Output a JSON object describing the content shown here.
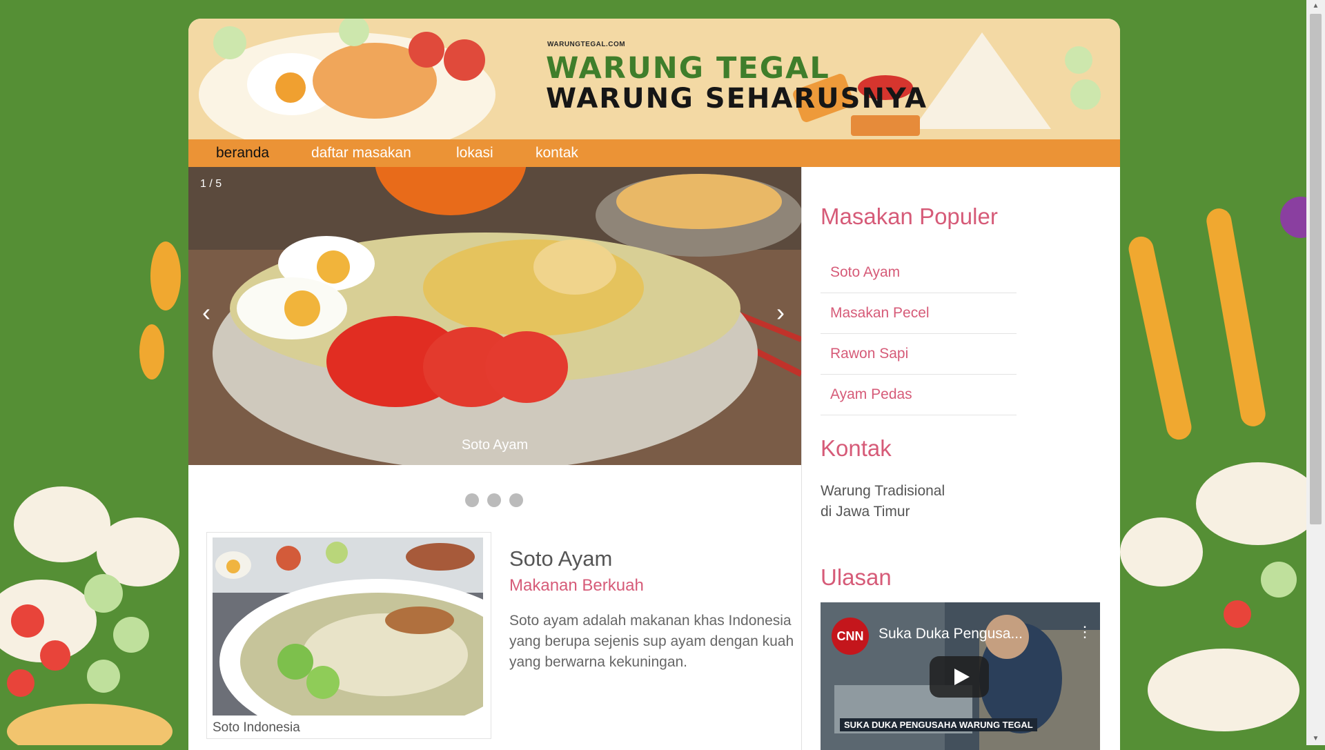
{
  "banner": {
    "site_url": "WARUNGTEGAL.COM",
    "title": "WARUNG TEGAL",
    "subtitle": "WARUNG SEHARUSNYA"
  },
  "nav": {
    "items": [
      {
        "label": "beranda"
      },
      {
        "label": "daftar masakan"
      },
      {
        "label": "lokasi"
      },
      {
        "label": "kontak"
      }
    ]
  },
  "slider": {
    "counter": "1 / 5",
    "caption": "Soto Ayam",
    "prev_glyph": "‹",
    "next_glyph": "›"
  },
  "article": {
    "image_caption": "Soto Indonesia",
    "title": "Soto Ayam",
    "subtitle": "Makanan Berkuah",
    "text": "Soto ayam adalah makanan khas Indonesia yang berupa sejenis sup ayam dengan kuah yang berwarna kekuningan."
  },
  "sidebar": {
    "popular_heading": "Masakan Populer",
    "popular_items": [
      {
        "label": "Soto Ayam"
      },
      {
        "label": "Masakan Pecel"
      },
      {
        "label": "Rawon Sapi"
      },
      {
        "label": "Ayam Pedas"
      }
    ],
    "contact_heading": "Kontak",
    "contact_line1": "Warung Tradisional",
    "contact_line2": "di Jawa Timur",
    "review_heading": "Ulasan",
    "video_title": "Suka Duka Pengusa...",
    "video_channel_logo": "CNN",
    "video_lower_text": "SUKA DUKA PENGUSAHA WARUNG TEGAL"
  },
  "colors": {
    "background": "#558f35",
    "nav": "#eb9336",
    "accent_pink": "#d65b78",
    "brand_green": "#3f7e2b",
    "banner_bg": "#f3d9a4"
  }
}
